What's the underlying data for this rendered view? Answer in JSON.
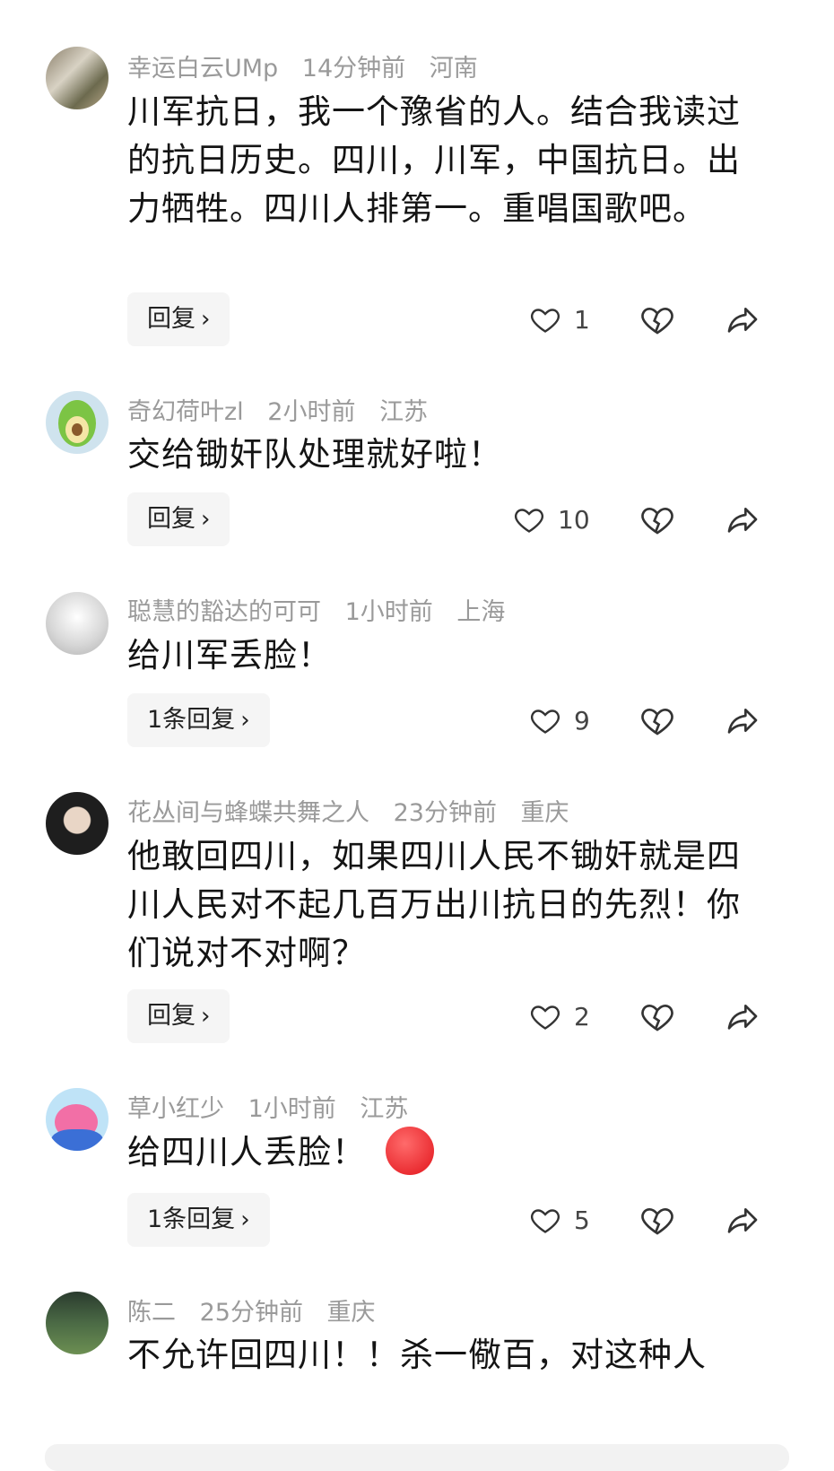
{
  "comments": [
    {
      "user": "幸运白云UMp",
      "time": "14分钟前",
      "location": "河南",
      "text": "川军抗日，我一个豫省的人。结合我读过的抗日历史。四川，川军，中国抗日。出力牺牲。四川人排第一。重唱国歌吧。",
      "reply_label": "回复",
      "likes": "1"
    },
    {
      "user": "奇幻荷叶zl",
      "time": "2小时前",
      "location": "江苏",
      "text": "交给锄奸队处理就好啦！",
      "reply_label": "回复",
      "likes": "10"
    },
    {
      "user": "聪慧的豁达的可可",
      "time": "1小时前",
      "location": "上海",
      "text": "给川军丢脸！",
      "reply_label": "1条回复",
      "likes": "9"
    },
    {
      "user": "花丛间与蜂蝶共舞之人",
      "time": "23分钟前",
      "location": "重庆",
      "text": "他敢回四川，如果四川人民不锄奸就是四川人民对不起几百万出川抗日的先烈！你们说对不对啊？",
      "reply_label": "回复",
      "likes": "2"
    },
    {
      "user": "草小红少",
      "time": "1小时前",
      "location": "江苏",
      "text": "给四川人丢脸！",
      "reply_label": "1条回复",
      "likes": "5"
    },
    {
      "user": "陈二",
      "time": "25分钟前",
      "location": "重庆",
      "text": "不允许回四川！！杀一儆百，对这种人"
    }
  ],
  "icons": {
    "like": "heart-outline-icon",
    "dislike": "broken-heart-icon",
    "share": "share-arrow-icon",
    "chevron": "chevron-right-icon"
  },
  "colors": {
    "text": "#141414",
    "meta": "#9a9a9a",
    "reply_bg": "#f5f5f5",
    "emoji_red": "#e2141b"
  }
}
